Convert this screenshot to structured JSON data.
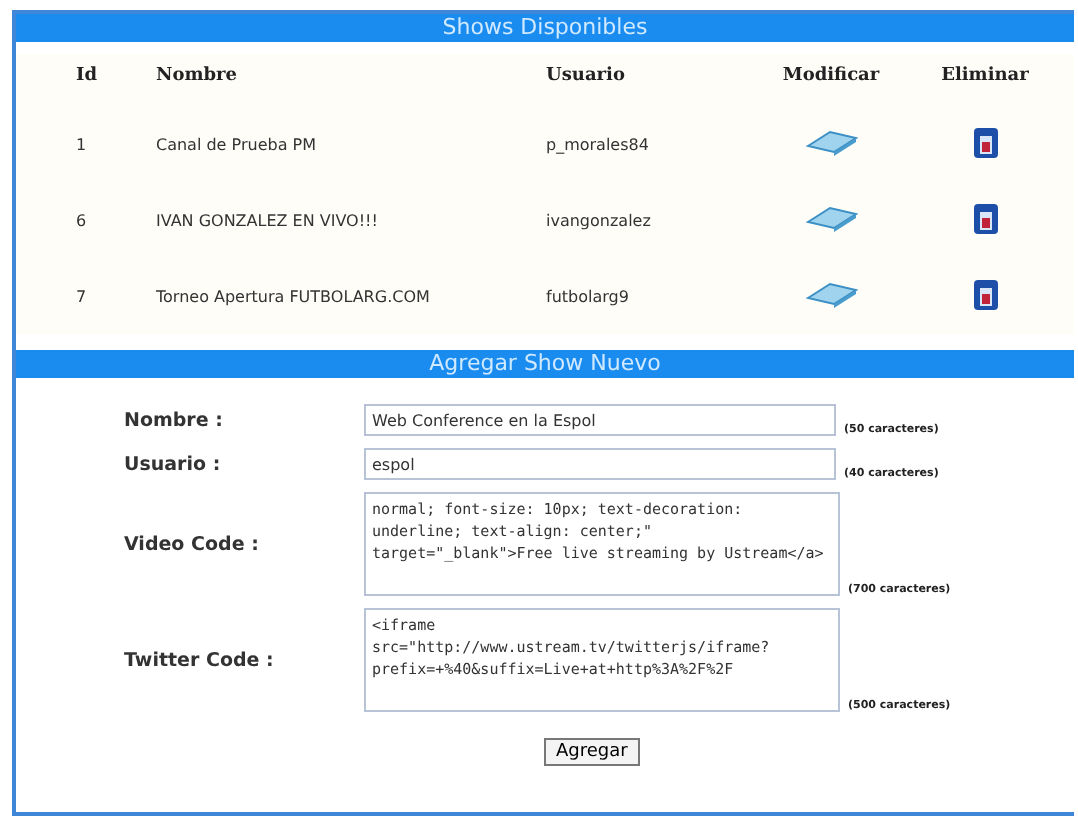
{
  "shows_panel": {
    "title": "Shows Disponibles",
    "columns": [
      "Id",
      "Nombre",
      "Usuario",
      "Modificar",
      "Eliminar"
    ],
    "rows": [
      {
        "id": "1",
        "nombre": "Canal de Prueba PM",
        "usuario": "p_morales84"
      },
      {
        "id": "6",
        "nombre": "IVAN GONZALEZ EN VIVO!!!",
        "usuario": "ivangonzalez"
      },
      {
        "id": "7",
        "nombre": "Torneo Apertura FUTBOLARG.COM",
        "usuario": "futbolarg9"
      }
    ]
  },
  "add_panel": {
    "title": "Agregar Show Nuevo",
    "fields": [
      {
        "kind": "input",
        "label": "Nombre :",
        "value": "Web Conference en la Espol",
        "hint": "(50 caracteres)"
      },
      {
        "kind": "input",
        "label": "Usuario :",
        "value": "espol",
        "hint": "(40 caracteres)"
      },
      {
        "kind": "textarea",
        "label": "Video Code :",
        "value": "normal; font-size: 10px; text-decoration: underline; text-align: center;\" target=\"_blank\">Free live streaming by Ustream</a>",
        "hint": "(700 caracteres)"
      },
      {
        "kind": "textarea",
        "label": "Twitter Code :",
        "value": "<iframe src=\"http://www.ustream.tv/twitterjs/iframe?prefix=+%40&suffix=Live+at+http%3A%2F%2F",
        "hint": "(500 caracteres)"
      }
    ],
    "button": "Agregar"
  }
}
